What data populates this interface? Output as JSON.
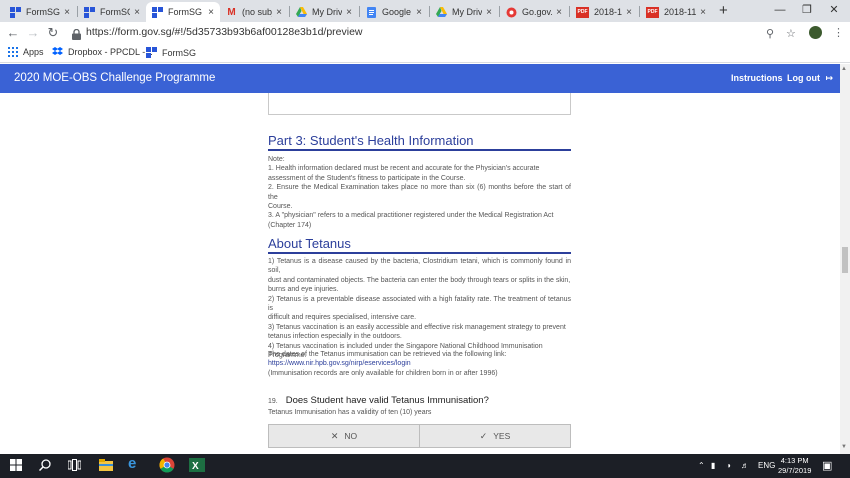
{
  "browser": {
    "tabs": [
      {
        "title": "FormSG",
        "icon": "formsg-icon",
        "active": false
      },
      {
        "title": "FormSG",
        "icon": "formsg-icon",
        "active": false
      },
      {
        "title": "FormSG",
        "icon": "formsg-icon",
        "active": true
      },
      {
        "title": "(no subje",
        "icon": "gmail-icon",
        "active": false
      },
      {
        "title": "My Drive",
        "icon": "drive-icon",
        "active": false
      },
      {
        "title": "Google D",
        "icon": "docs-icon",
        "active": false
      },
      {
        "title": "My Drive",
        "icon": "drive-icon",
        "active": false
      },
      {
        "title": "Go.gov.s",
        "icon": "gogov-icon",
        "active": false
      },
      {
        "title": "2018-11",
        "icon": "pdf-icon",
        "active": false
      },
      {
        "title": "2018-11",
        "icon": "pdf-icon",
        "active": false
      }
    ],
    "new_tab": "+",
    "close_glyph": "×",
    "url": {
      "scheme": "https://",
      "host": "form.gov.sg",
      "path": "/#!/5d35733b93b6af00128e3b1d/preview"
    },
    "bookmarks": [
      {
        "label": "Apps",
        "icon": "apps-grid-icon"
      },
      {
        "label": "Dropbox - PPCDL -...",
        "icon": "dropbox-icon"
      },
      {
        "label": "FormSG",
        "icon": "formsg-icon"
      }
    ]
  },
  "app": {
    "title": "2020 MOE-OBS Challenge Programme",
    "nav": {
      "instructions": "Instructions",
      "logout": "Log out"
    }
  },
  "sections": {
    "health": {
      "title": "Part 3: Student's Health Information",
      "lines": [
        "Note:",
        "1. Health information declared must be recent and accurate for the Physician's accurate",
        "assessment of the Student's fitness to participate in the Course.",
        "2. Ensure the Medical Examination takes place no more than six (6) months before the start of the",
        "Course.",
        "3. A \"physician\" refers to a medical practitioner registered under the Medical Registration Act",
        "(Chapter 174)"
      ]
    },
    "tetanus": {
      "title": "About Tetanus",
      "lines": [
        "1) Tetanus is a disease caused by the bacteria, Clostridium tetani, which is commonly found in soil,",
        "dust and contaminated objects. The bacteria can enter the body through tears or splits in the skin,",
        "burns and eye injuries.",
        "2) Tetanus is a preventable disease associated with a high fatality rate. The treatment of tetanus is",
        "difficult and requires specialised, intensive care.",
        "3) Tetanus vaccination is an easily accessible and effective risk management strategy to prevent",
        "tetanus infection especially in the outdoors.",
        "4) Tetanus vaccination is included under the Singapore National Childhood Immunisation",
        "Programme."
      ],
      "retrieve_line": "The dates of the Tetanus immunisation can be retrieved via the following link:",
      "link": "https://www.nir.hpb.gov.sg/nirp/eservices/login",
      "note": "(Immunisation records are only available for children born in or after 1996)"
    }
  },
  "question": {
    "number": "19.",
    "text": "Does Student have valid Tetanus Immunisation?",
    "hint": "Tetanus Immunisation has a validity of ten (10) years",
    "options": [
      {
        "label": "NO",
        "icon": "x-icon"
      },
      {
        "label": "YES",
        "icon": "check-icon"
      }
    ]
  },
  "taskbar": {
    "language": "ENG",
    "time": "4:13 PM",
    "date": "29/7/2019"
  },
  "colors": {
    "header": "#3a62d5",
    "section_title": "#2c3f9b",
    "taskbar": "#1c1f26"
  }
}
